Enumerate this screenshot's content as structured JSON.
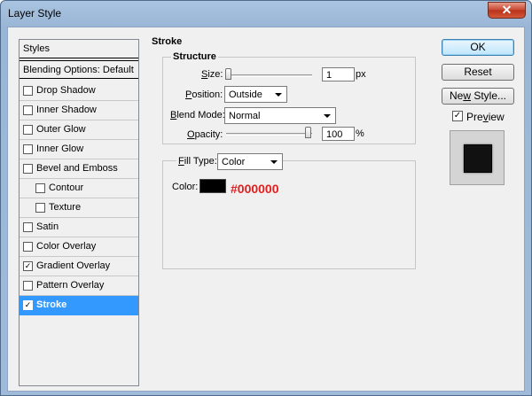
{
  "window": {
    "title": "Layer Style",
    "close_glyph": "✕",
    "close_icon": "close-icon"
  },
  "styles_panel": {
    "header": "Styles",
    "blending_options": "Blending Options: Default",
    "items": [
      {
        "label": "Drop Shadow",
        "checked": false,
        "indent": false,
        "selected": false
      },
      {
        "label": "Inner Shadow",
        "checked": false,
        "indent": false,
        "selected": false
      },
      {
        "label": "Outer Glow",
        "checked": false,
        "indent": false,
        "selected": false
      },
      {
        "label": "Inner Glow",
        "checked": false,
        "indent": false,
        "selected": false
      },
      {
        "label": "Bevel and Emboss",
        "checked": false,
        "indent": false,
        "selected": false
      },
      {
        "label": "Contour",
        "checked": false,
        "indent": true,
        "selected": false
      },
      {
        "label": "Texture",
        "checked": false,
        "indent": true,
        "selected": false
      },
      {
        "label": "Satin",
        "checked": false,
        "indent": false,
        "selected": false
      },
      {
        "label": "Color Overlay",
        "checked": false,
        "indent": false,
        "selected": false
      },
      {
        "label": "Gradient Overlay",
        "checked": true,
        "indent": false,
        "selected": false
      },
      {
        "label": "Pattern Overlay",
        "checked": false,
        "indent": false,
        "selected": false
      },
      {
        "label": "Stroke",
        "checked": true,
        "indent": false,
        "selected": true
      }
    ]
  },
  "stroke": {
    "section_title": "Stroke",
    "structure_title": "Structure",
    "size": {
      "label_ul": "S",
      "label_rest": "ize:",
      "value": "1",
      "unit": "px",
      "slider_fraction": 0.0
    },
    "position": {
      "label_ul": "P",
      "label_rest": "osition:",
      "value": "Outside"
    },
    "blend_mode": {
      "label_ul": "B",
      "label_rest": "lend Mode:",
      "value": "Normal"
    },
    "opacity": {
      "label_ul": "O",
      "label_rest": "pacity:",
      "value": "100",
      "unit": "%",
      "slider_fraction": 1.0
    },
    "fill_type": {
      "label_ul": "F",
      "label_rest": "ill Type:",
      "value": "Color"
    },
    "color": {
      "label": "Color:",
      "hex": "#000000",
      "annotation_color": "#e02020"
    }
  },
  "buttons": {
    "ok": "OK",
    "reset": "Reset",
    "new_style_ul": "w",
    "new_style_pre": "Ne",
    "new_style_post": " Style...",
    "preview_ul": "v",
    "preview_pre": "Pre",
    "preview_post": "iew",
    "preview_checked": true
  },
  "colors": {
    "selection": "#3399ff",
    "titlebar": "#9fbbd9",
    "dialog": "#f0f0f0"
  }
}
